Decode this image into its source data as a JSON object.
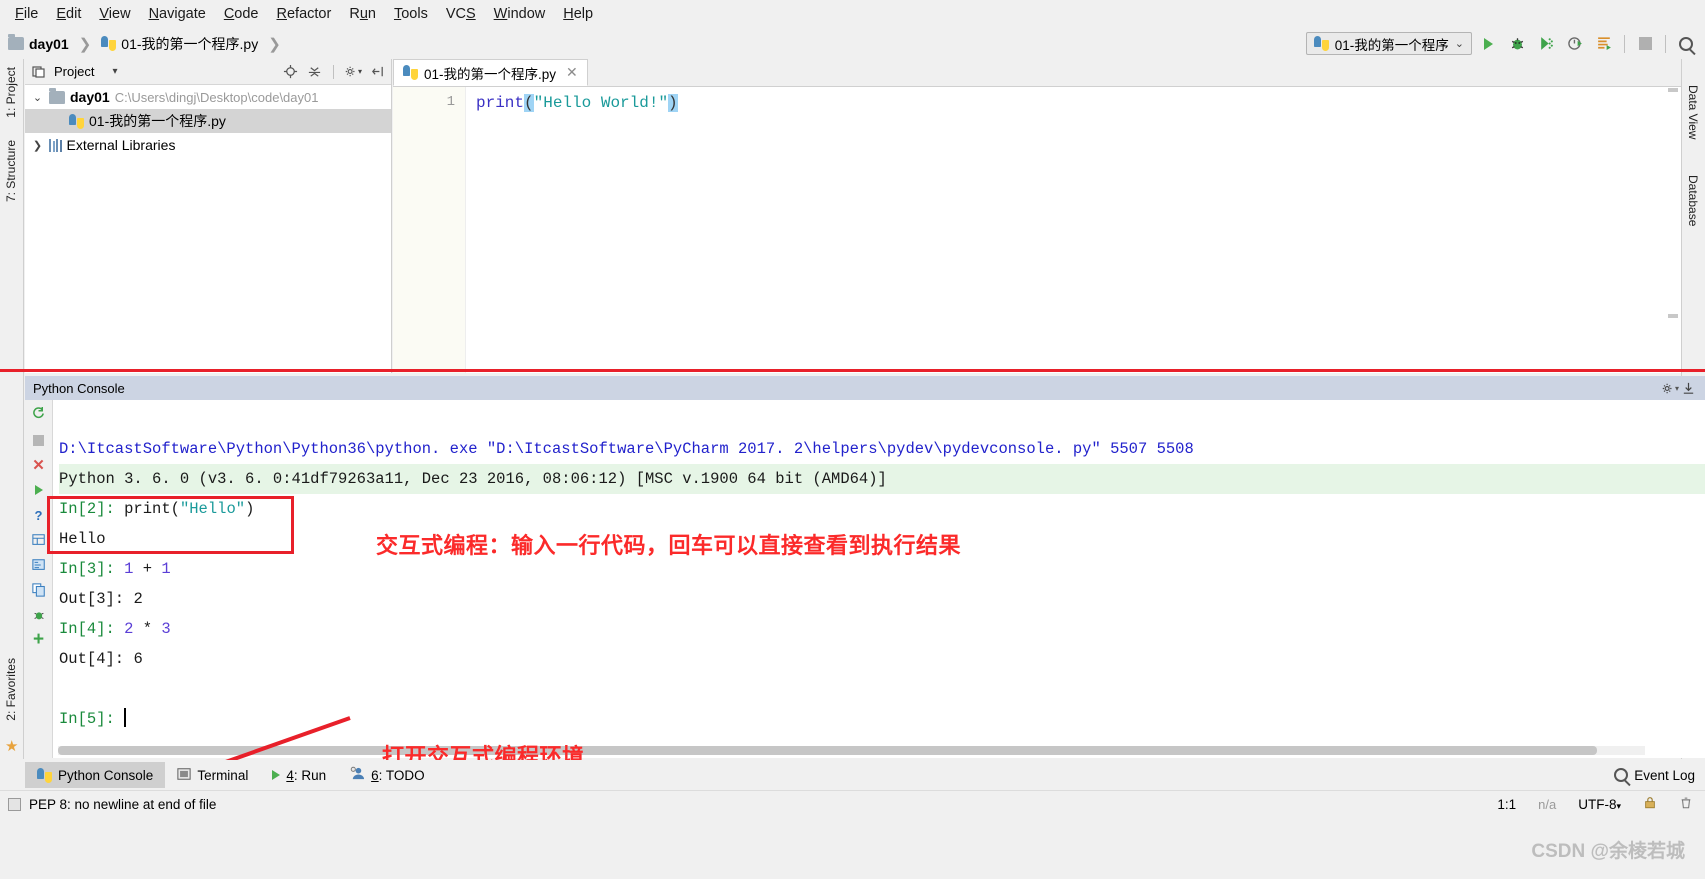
{
  "menu": {
    "items": [
      {
        "label": "File",
        "mnemonic": "F"
      },
      {
        "label": "Edit",
        "mnemonic": "E"
      },
      {
        "label": "View",
        "mnemonic": "V"
      },
      {
        "label": "Navigate",
        "mnemonic": "N"
      },
      {
        "label": "Code",
        "mnemonic": "C"
      },
      {
        "label": "Refactor",
        "mnemonic": "R"
      },
      {
        "label": "Run",
        "mnemonic": "u"
      },
      {
        "label": "Tools",
        "mnemonic": "T"
      },
      {
        "label": "VCS",
        "mnemonic": "S"
      },
      {
        "label": "Window",
        "mnemonic": "W"
      },
      {
        "label": "Help",
        "mnemonic": "H"
      }
    ]
  },
  "breadcrumb": {
    "project": "day01",
    "file": "01-我的第一个程序.py",
    "sep": "❯"
  },
  "toolbar": {
    "run_config": "01-我的第一个程序",
    "chevron": "⌄",
    "buttons": [
      {
        "name": "run",
        "glyph": "▶"
      },
      {
        "name": "debug",
        "glyph": "🐞"
      },
      {
        "name": "coverage",
        "glyph": "▶"
      },
      {
        "name": "profile",
        "glyph": "◔"
      },
      {
        "name": "run-with-console",
        "glyph": "≡"
      },
      {
        "name": "stop",
        "glyph": "■"
      },
      {
        "name": "search",
        "glyph": "🔍"
      }
    ]
  },
  "left_strip": {
    "tabs": [
      "1: Project",
      "7: Structure",
      "2: Favorites"
    ]
  },
  "right_strip": {
    "tabs": [
      "Data View",
      "Database"
    ]
  },
  "project_panel": {
    "title": "Project",
    "dropdown_glyph": "▾",
    "header_icons": [
      "locate-icon",
      "collapse-all-icon",
      "settings-icon",
      "hide-icon"
    ],
    "tree": [
      {
        "label": "day01",
        "path": "C:\\Users\\dingj\\Desktop\\code\\day01",
        "arrow": "⌄",
        "icon": "folder-icon",
        "selected": false,
        "indent": 0
      },
      {
        "label": "01-我的第一个程序.py",
        "path": "",
        "arrow": "",
        "icon": "python-file-icon",
        "selected": true,
        "indent": 1
      },
      {
        "label": "External Libraries",
        "path": "",
        "arrow": "❯",
        "icon": "library-icon",
        "selected": false,
        "indent": 0
      }
    ]
  },
  "editor": {
    "tab_label": "01-我的第一个程序.py",
    "close_glyph": "✕",
    "line_number": "1",
    "code": {
      "fn": "print",
      "open_paren": "(",
      "string": "\"Hello World!\"",
      "close_paren": ")"
    }
  },
  "console": {
    "title": "Python Console",
    "gutter_icons": [
      "rerun-icon",
      "stop-icon",
      "close-icon",
      "execute-icon",
      "help-icon",
      "show-variables-icon",
      "attach-icon",
      "copy-icon",
      "bug-icon",
      "new-icon"
    ],
    "lines": [
      {
        "type": "cmd",
        "text": "D:\\ItcastSoftware\\Python\\Python36\\python. exe \"D:\\ItcastSoftware\\PyCharm 2017. 2\\helpers\\pydev\\pydevconsole. py\" 5507 5508"
      },
      {
        "type": "version",
        "text": "Python 3. 6. 0 (v3. 6. 0:41df79263a11, Dec 23 2016, 08:06:12) [MSC v.1900 64 bit (AMD64)]"
      },
      {
        "type": "in",
        "prompt": "In[2]:",
        "code_plain": " print(",
        "code_str": "\"Hello\"",
        "code_tail": ")"
      },
      {
        "type": "out_plain",
        "text": "Hello"
      },
      {
        "type": "in_expr",
        "prompt": "In[3]:",
        "num1": "1",
        "op": "+",
        "num2": "1"
      },
      {
        "type": "out",
        "prompt": "Out[3]:",
        "value": "2"
      },
      {
        "type": "in_expr",
        "prompt": "In[4]:",
        "num1": "2",
        "op": "*",
        "num2": "3"
      },
      {
        "type": "out",
        "prompt": "Out[4]:",
        "value": "6"
      },
      {
        "type": "blank",
        "text": ""
      },
      {
        "type": "prompt",
        "prompt": "In[5]:"
      }
    ]
  },
  "annotations": {
    "text_top": "交互式编程：输入一行代码，回车可以直接查看到执行结果",
    "text_bottom": "打开交互式编程环境",
    "color": "#fb2a2a"
  },
  "bottom_tabs": [
    {
      "label": "Python Console",
      "mnemonic": "",
      "icon": "python-icon",
      "active": true
    },
    {
      "label": "Terminal",
      "mnemonic": "",
      "icon": "terminal-icon",
      "active": false
    },
    {
      "label": "4: Run",
      "mnemonic": "4",
      "icon": "run-icon",
      "active": false
    },
    {
      "label": "6: TODO",
      "mnemonic": "6",
      "icon": "todo-icon",
      "active": false
    }
  ],
  "event_log": {
    "label": "Event Log",
    "icon": "magnifier-icon"
  },
  "status": {
    "message": "PEP 8: no newline at end of file",
    "caret": "1:1",
    "line_sep": "n/a",
    "encoding": "UTF-8",
    "encoding_chevron": "▾"
  },
  "watermark": "CSDN @余棱若城"
}
